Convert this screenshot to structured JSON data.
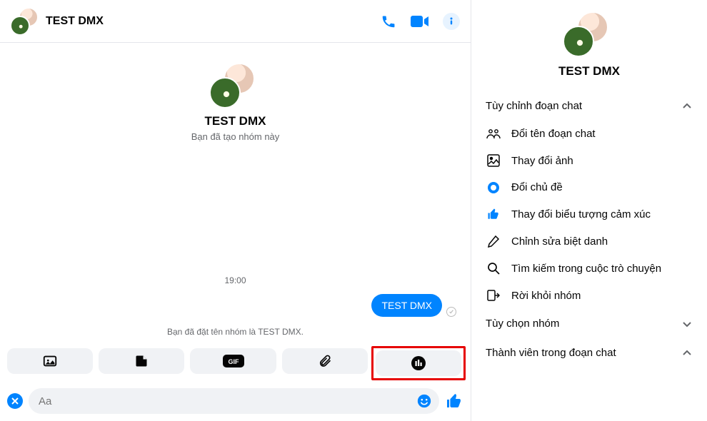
{
  "header": {
    "title": "TEST DMX"
  },
  "intro": {
    "groupName": "TEST DMX",
    "subtitle": "Bạn đã tạo nhóm này"
  },
  "timeline": {
    "timeLabel": "19:00",
    "messageText": "TEST DMX",
    "systemMsg": "Bạn đã đặt tên nhóm là TEST DMX."
  },
  "composer": {
    "placeholder": "Aa"
  },
  "side": {
    "title": "TEST DMX",
    "sections": {
      "customize": "Tùy chỉnh đoạn chat",
      "options": [
        "Đổi tên đoạn chat",
        "Thay đổi ảnh",
        "Đổi chủ đề",
        "Thay đổi biểu tượng cảm xúc",
        "Chỉnh sửa biệt danh",
        "Tìm kiếm trong cuộc trò chuyện",
        "Rời khỏi nhóm"
      ],
      "groupOptions": "Tùy chọn nhóm",
      "members": "Thành viên trong đoạn chat"
    }
  }
}
